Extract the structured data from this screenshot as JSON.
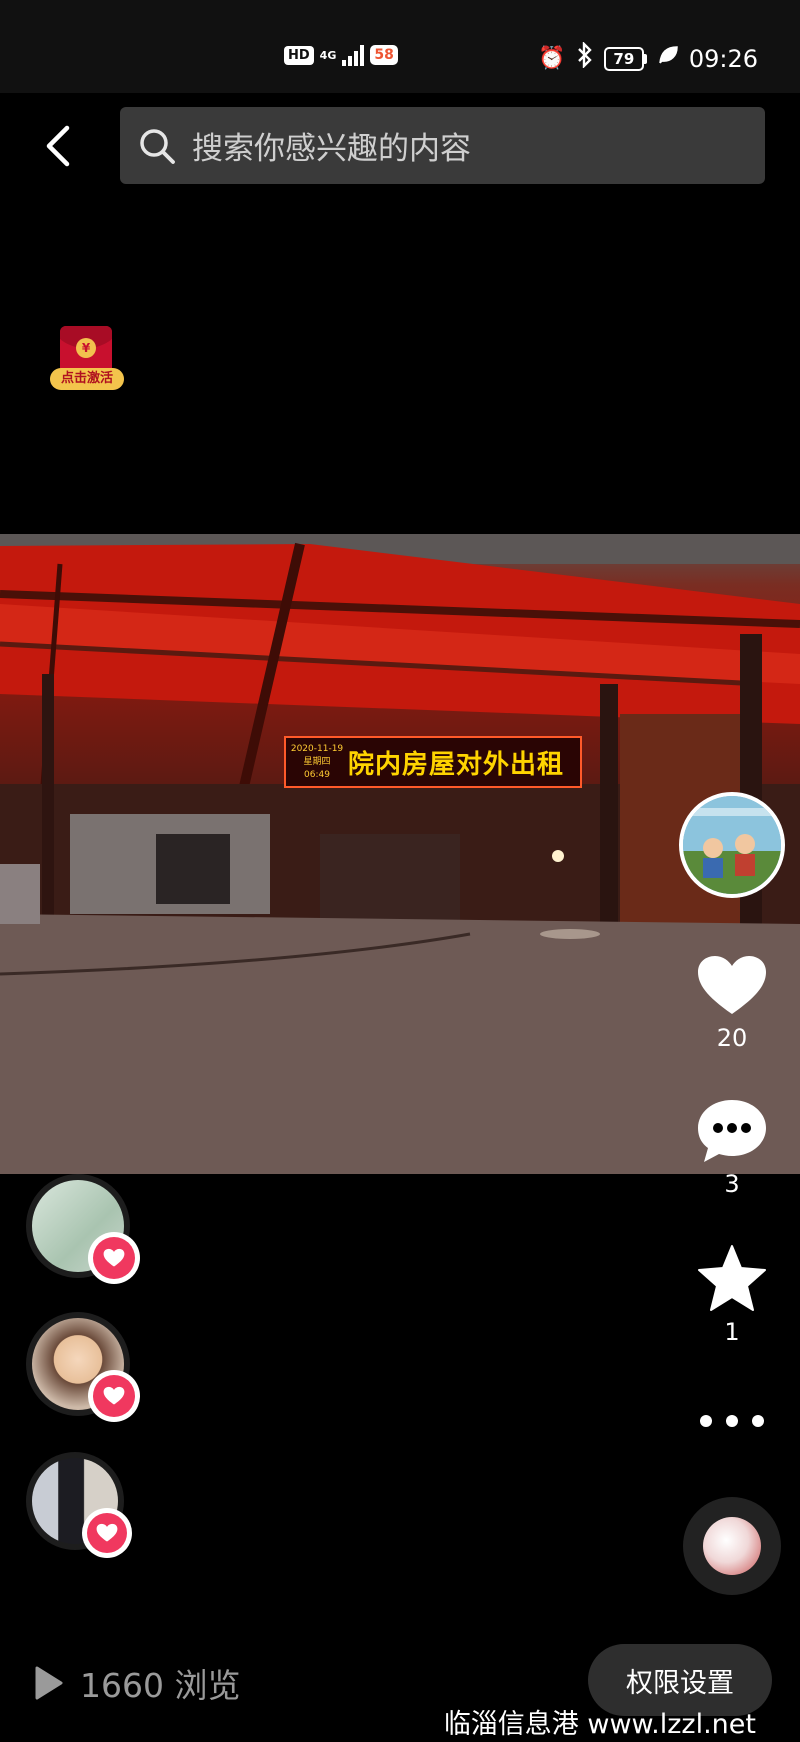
{
  "status_bar": {
    "hd": "HD",
    "network": "4G",
    "app_badge": "58",
    "battery": "79",
    "time": "09:26"
  },
  "search": {
    "placeholder": "搜索你感兴趣的内容"
  },
  "red_packet": {
    "label": "点击激活"
  },
  "video": {
    "led_date": "2020-11-19",
    "led_weekday": "星期四",
    "led_clock": "06:49",
    "led_message": "院内房屋对外出租"
  },
  "actions": {
    "likes": "20",
    "comments": "3",
    "favorites": "1"
  },
  "footer": {
    "views": "1660 浏览",
    "permission_button": "权限设置",
    "watermark": "临淄信息港 www.lzzl.net"
  },
  "colors": {
    "heart_badge": "#f0385f",
    "search_bg": "#3a3a3a",
    "led_text": "#ffd400"
  },
  "icons": [
    "back-icon",
    "search-icon",
    "heart-icon",
    "comment-icon",
    "star-icon",
    "more-icon",
    "play-icon",
    "music-disc-icon"
  ]
}
